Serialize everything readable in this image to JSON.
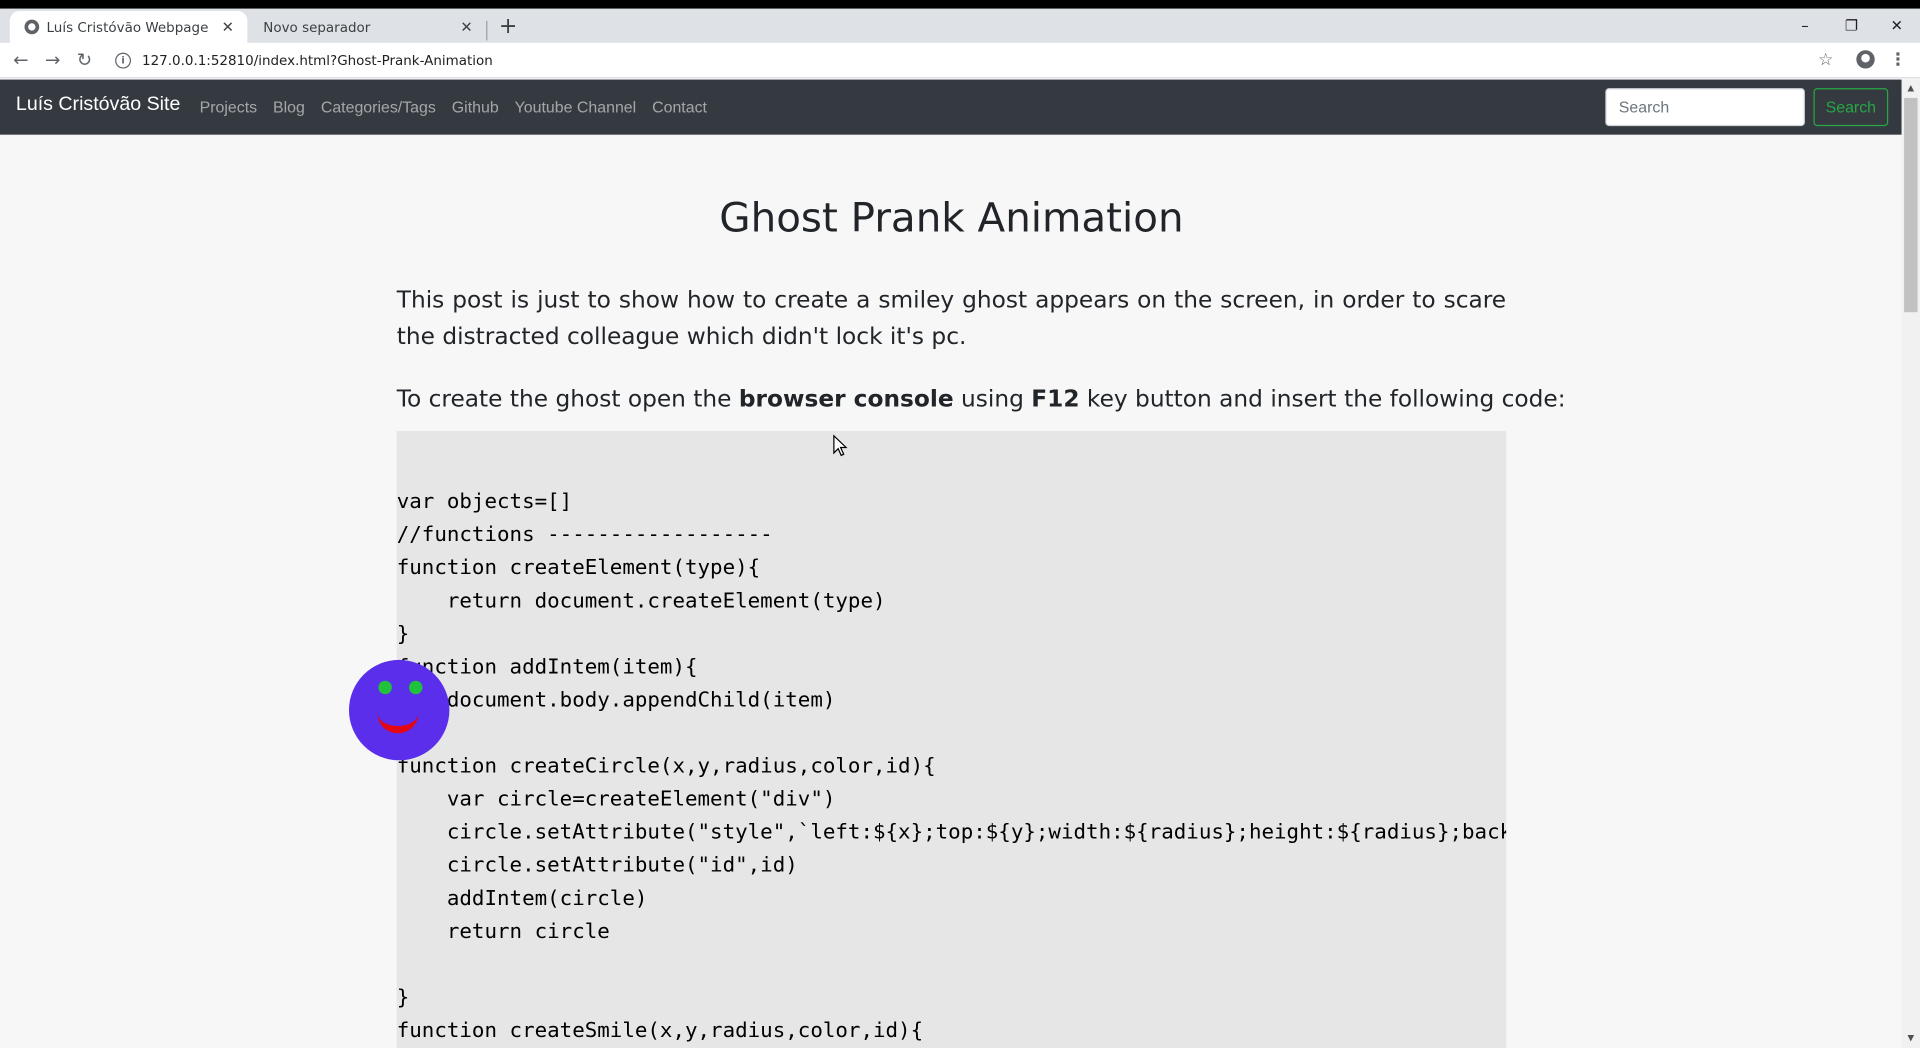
{
  "browser": {
    "tabs": [
      {
        "title": "Luís Cristóvão Webpage",
        "active": true
      },
      {
        "title": "Novo separador",
        "active": false
      }
    ],
    "new_tab_label": "+",
    "url": "127.0.0.1:52810/index.html?Ghost-Prank-Animation",
    "window_controls": {
      "minimize": "–",
      "restore": "❐",
      "close": "✕"
    }
  },
  "site": {
    "brand": "Luís Cristóvão Site",
    "nav": [
      "Projects",
      "Blog",
      "Categories/Tags",
      "Github",
      "Youtube Channel",
      "Contact"
    ],
    "search_placeholder": "Search",
    "search_button": "Search"
  },
  "article": {
    "title": "Ghost Prank Animation",
    "intro": "This post is just to show how to create a smiley ghost appears on the screen, in order to scare the distracted colleague which didn't lock it's pc.",
    "instruction_prefix": "To create the ghost open the ",
    "instruction_bold1": "browser console",
    "instruction_mid": " using ",
    "instruction_bold2": "F12",
    "instruction_suffix": " key button and insert the following code:",
    "code": "var objects=[]\n//functions ------------------\nfunction createElement(type){\n    return document.createElement(type)\n}\nfunction addIntem(item){\n    document.body.appendChild(item)\n}\nfunction createCircle(x,y,radius,color,id){\n    var circle=createElement(\"div\")\n    circle.setAttribute(\"style\",`left:${x};top:${y};width:${radius};height:${radius};backgro\n    circle.setAttribute(\"id\",id)\n    addIntem(circle)\n    return circle\n\n}\nfunction createSmile(x,y,radius,color,id){"
  },
  "colors": {
    "navbar_bg": "#343a40",
    "search_button": "#28a745",
    "ghost_body": "#5a2eea",
    "ghost_eyes": "#1fc23a",
    "ghost_mouth": "#e30614"
  }
}
